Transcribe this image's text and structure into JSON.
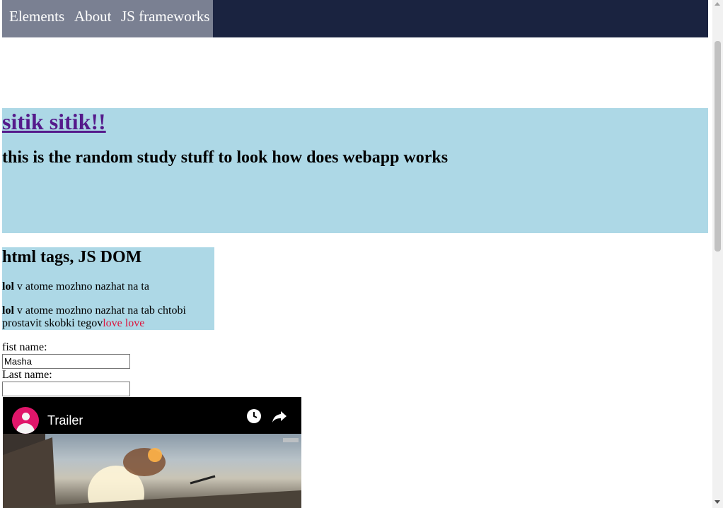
{
  "nav": {
    "items": [
      {
        "label": "Elements"
      },
      {
        "label": "About"
      },
      {
        "label": "JS frameworks"
      }
    ]
  },
  "hero": {
    "title": "sitik sitik!!",
    "subtitle": "this is the random study stuff to look how does webapp works"
  },
  "info": {
    "heading": "html tags, JS DOM",
    "p1_bold": "lol",
    "p1_text": " v atome mozhno nazhat na ta",
    "p2_bold": "lol",
    "p2_text": " v atome mozhno nazhat na tab chtobi prostavit skobki tegov",
    "p2_highlight": "love love"
  },
  "form": {
    "first_label": "fist name:",
    "first_value": "Masha",
    "last_label": "Last name:",
    "last_value": ""
  },
  "video": {
    "title": "Trailer",
    "icons": [
      "avatar-icon",
      "clock-icon",
      "share-icon"
    ]
  },
  "colors": {
    "nav_bg": "#1a2340",
    "nav_active": "#7a8092",
    "panel_bg": "#add8e6",
    "link": "#551a8b",
    "highlight": "#dc143c"
  }
}
